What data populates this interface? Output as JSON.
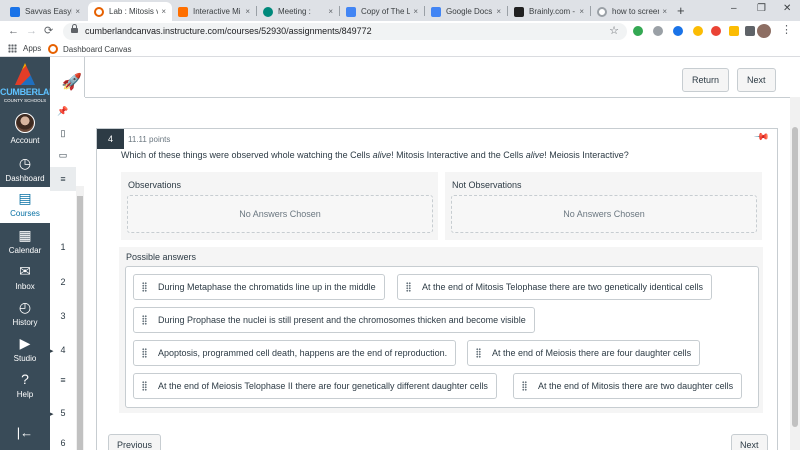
{
  "browser": {
    "tabs": [
      {
        "label": "Savvas EasyBr",
        "favicon_color": "#1a73e8",
        "close": "×"
      },
      {
        "label": "Lab : Mitosis v",
        "favicon_color": "#e66000",
        "close": "×"
      },
      {
        "label": "Interactive Mi",
        "favicon_color": "#ff6f00",
        "close": "×"
      },
      {
        "label": "Meeting :",
        "favicon_color": "#00897b",
        "close": "×"
      },
      {
        "label": "Copy of The Li",
        "favicon_color": "#4285f4",
        "close": "×"
      },
      {
        "label": "Google Docs",
        "favicon_color": "#4285f4",
        "close": "×"
      },
      {
        "label": "Brainly.com -",
        "favicon_color": "#212121",
        "close": "×"
      },
      {
        "label": "how to screen",
        "favicon_color": "#9aa0a6",
        "close": "×"
      }
    ],
    "new_tab": "+",
    "window_controls": {
      "minimize": "–",
      "restore": "❐",
      "close": "✕"
    },
    "nav": {
      "back": "←",
      "forward": "→",
      "reload": "⟳"
    },
    "url": "cumberlandcanvas.instructure.com/courses/52930/assignments/849772",
    "star": "☆",
    "bookmarks": [
      {
        "label": "Apps",
        "icon": "apps-grid-icon"
      },
      {
        "label": "Dashboard Canvas",
        "icon": "canvas-icon"
      }
    ],
    "menu": "⋮"
  },
  "global_nav": {
    "logo": {
      "name": "CUMBERLAND",
      "sub": "COUNTY SCHOOLS"
    },
    "items": [
      {
        "label": "Account",
        "icon": "avatar"
      },
      {
        "label": "Dashboard",
        "icon": "◷"
      },
      {
        "label": "Courses",
        "icon": "▤",
        "active": true
      },
      {
        "label": "Calendar",
        "icon": "▦"
      },
      {
        "label": "Inbox",
        "icon": "✉"
      },
      {
        "label": "History",
        "icon": "◴"
      },
      {
        "label": "Studio",
        "icon": "▶"
      },
      {
        "label": "Help",
        "icon": "?"
      }
    ],
    "collapse": "|←"
  },
  "quiz_nav": {
    "items": [
      "1",
      "2",
      "3",
      "4",
      "5",
      "6"
    ]
  },
  "topbar": {
    "return_label": "Return",
    "next_label": "Next"
  },
  "question": {
    "number": "4",
    "points": "11.11 points",
    "text_before": "Which of these things were observed whole watching the Cells ",
    "em1": "alive",
    "text_mid": "! Mitosis Interactive and the Cells ",
    "em2": "alive",
    "text_after": "! Meiosis Interactive?",
    "buckets": [
      {
        "title": "Observations",
        "empty": "No Answers Chosen"
      },
      {
        "title": "Not Observations",
        "empty": "No Answers Chosen"
      }
    ],
    "possible_title": "Possible answers",
    "answers": [
      "During Metaphase the chromatids line up in the middle",
      "At the end of Mitosis Telophase there are two genetically identical cells",
      "During Prophase the nuclei is still present and the chromosomes thicken and become visible",
      "Apoptosis, programmed cell death, happens are the end of reproduction.",
      "At the end of Meiosis there are four daughter cells",
      "At the end of Meiosis Telophase II there are four genetically different daughter cells",
      "At the end of Mitosis there are two daughter cells"
    ]
  },
  "pager": {
    "previous": "Previous",
    "next": "Next"
  }
}
